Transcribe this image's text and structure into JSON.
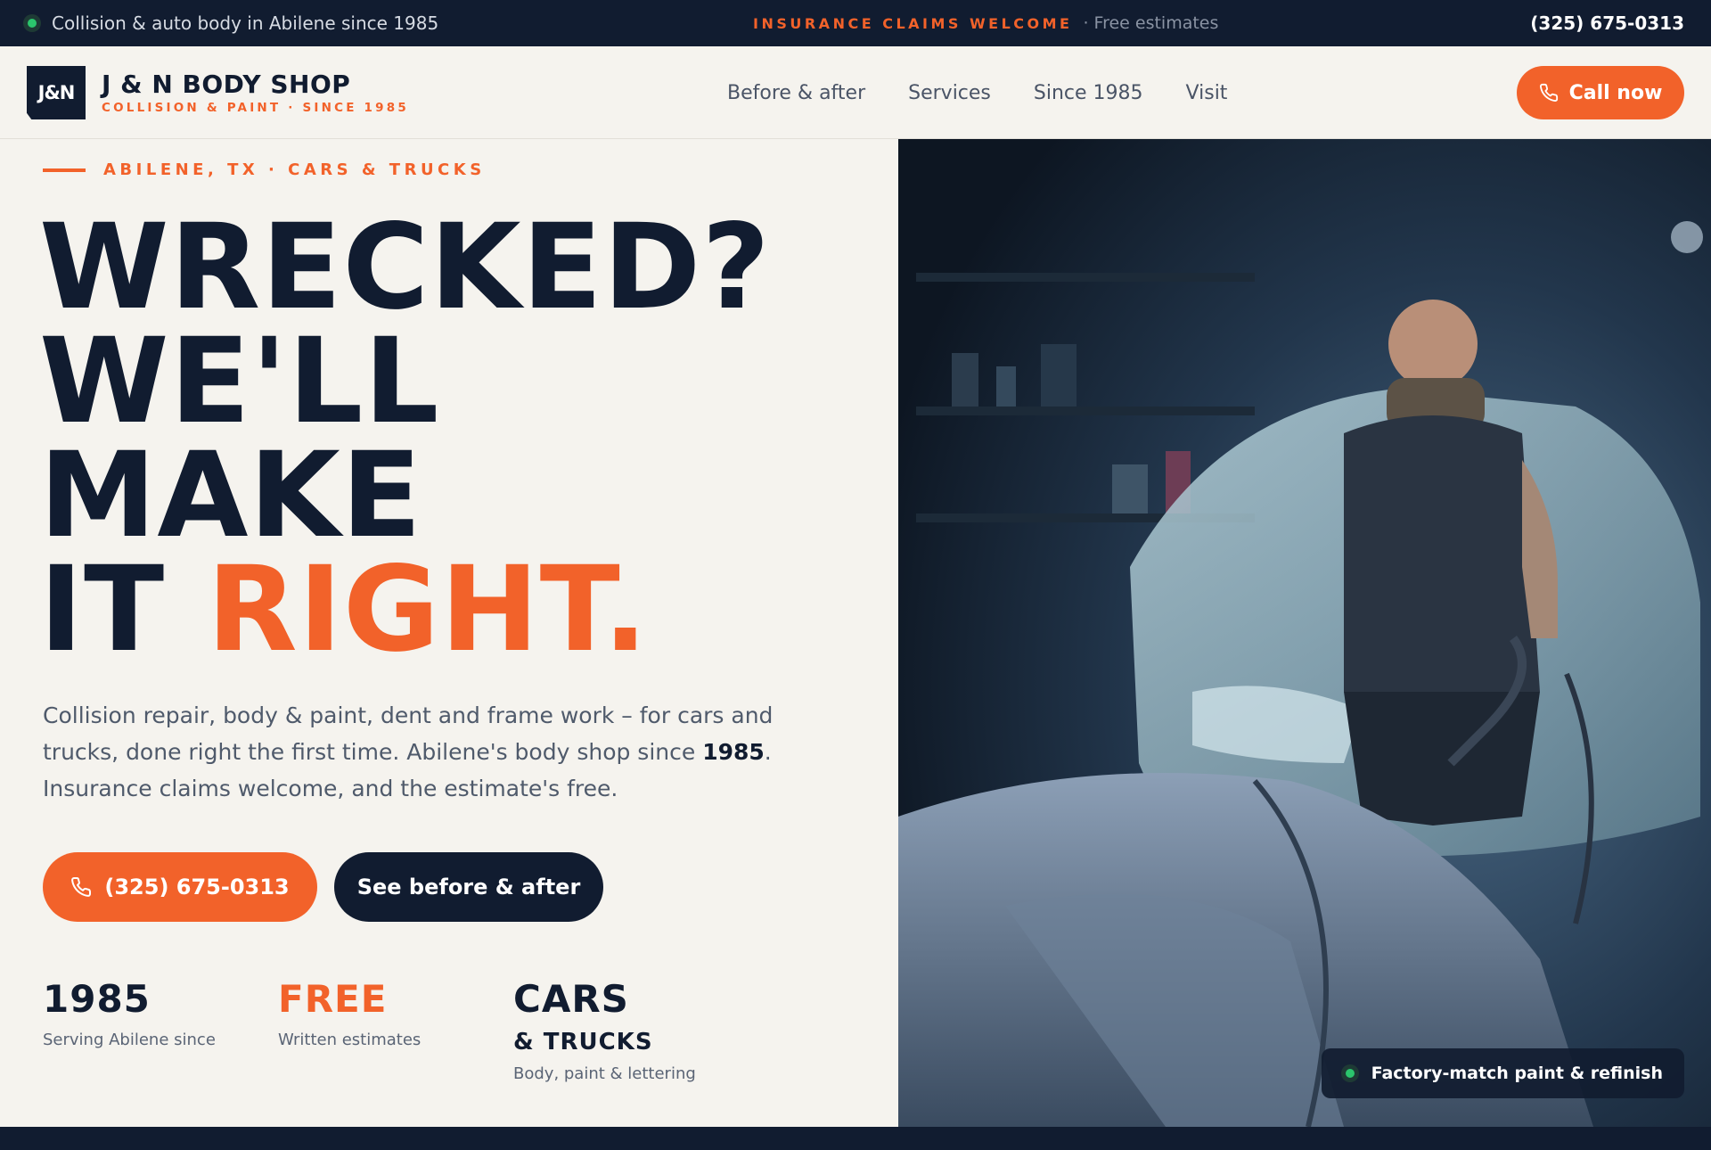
{
  "topbar": {
    "tagline": "Collision & auto body in Abilene since 1985",
    "insurance": "INSURANCE CLAIMS WELCOME",
    "estimates": "· Free estimates",
    "phone": "(325) 675-0313"
  },
  "nav": {
    "logo_mark": "J&N",
    "brand_name": "J & N BODY SHOP",
    "brand_sub": "COLLISION & PAINT · SINCE 1985",
    "links": [
      "Before & after",
      "Services",
      "Since 1985",
      "Visit"
    ],
    "call_label": "Call now"
  },
  "hero": {
    "eyebrow": "ABILENE, TX · CARS & TRUCKS",
    "headline_line1": "WRECKED?",
    "headline_line2": "WE'LL",
    "headline_line3": "MAKE",
    "headline_line4_a": "IT ",
    "headline_line4_b": "RIGHT.",
    "lede_a": "Collision repair, body & paint, dent and frame work – for cars and trucks, done right the first time. Abilene's body shop since ",
    "lede_year": "1985",
    "lede_b": ". Insurance claims welcome, and the estimate's free.",
    "primary_button": "(325) 675-0313",
    "secondary_button": "See before & after"
  },
  "stats": [
    {
      "big": "1985",
      "label": "Serving Abilene since"
    },
    {
      "big": "FREE",
      "label": "Written estimates"
    },
    {
      "big": "CARS",
      "sub": "& TRUCKS",
      "label": "Body, paint & lettering"
    }
  ],
  "photo_badge": "Factory-match paint & refinish",
  "icons": {
    "status_dot": "green-dot-icon",
    "phone": "phone-icon"
  },
  "colors": {
    "navy": "#111c30",
    "orange": "#f2622a",
    "cream": "#f5f3ee",
    "green": "#2bc56d"
  }
}
